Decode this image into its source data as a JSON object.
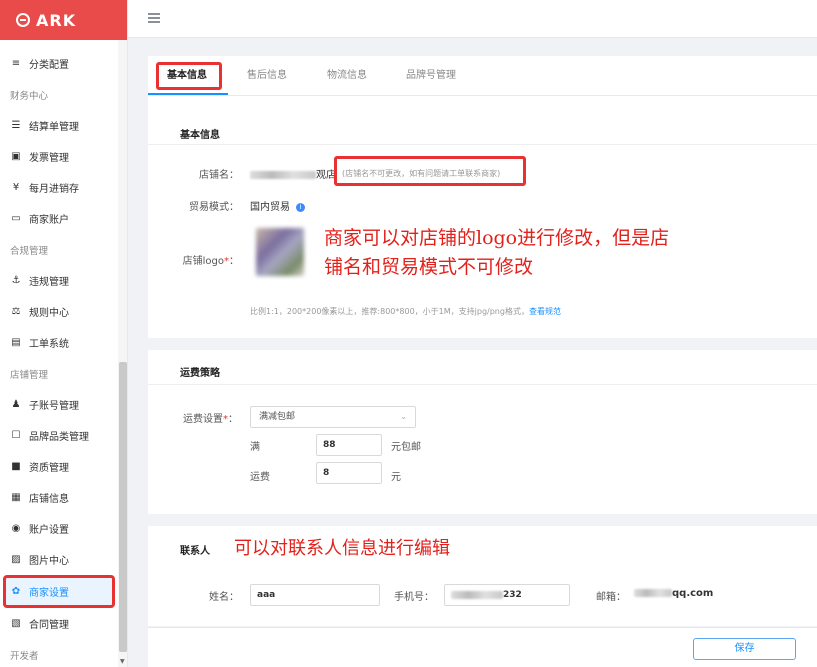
{
  "app": {
    "logo_text": "ARK",
    "brand_color": "#e94b4b",
    "accent_color": "#1890ff",
    "annotation_color": "#e3211b"
  },
  "sidebar": {
    "items": [
      {
        "type": "item",
        "icon": "menu-lines-icon",
        "glyph": "≡",
        "label": "分类配置"
      },
      {
        "type": "group",
        "label": "财务中心"
      },
      {
        "type": "item",
        "icon": "list-icon",
        "glyph": "☰",
        "label": "结算单管理"
      },
      {
        "type": "item",
        "icon": "invoice-icon",
        "glyph": "▣",
        "label": "发票管理"
      },
      {
        "type": "item",
        "icon": "yen-icon",
        "glyph": "¥",
        "label": "每月进销存"
      },
      {
        "type": "item",
        "icon": "card-icon",
        "glyph": "▭",
        "label": "商家账户"
      },
      {
        "type": "group",
        "label": "合规管理"
      },
      {
        "type": "item",
        "icon": "anchor-icon",
        "glyph": "⚓",
        "label": "违规管理"
      },
      {
        "type": "item",
        "icon": "scale-icon",
        "glyph": "⚖",
        "label": "规则中心"
      },
      {
        "type": "item",
        "icon": "calendar-icon",
        "glyph": "▤",
        "label": "工单系统"
      },
      {
        "type": "group",
        "label": "店铺管理"
      },
      {
        "type": "item",
        "icon": "user-icon",
        "glyph": "♟",
        "label": "子账号管理"
      },
      {
        "type": "item",
        "icon": "bookmark-outline-icon",
        "glyph": "☐",
        "label": "品牌品类管理"
      },
      {
        "type": "item",
        "icon": "bookmark-icon",
        "glyph": "■",
        "label": "资质管理"
      },
      {
        "type": "item",
        "icon": "id-card-icon",
        "glyph": "▦",
        "label": "店铺信息"
      },
      {
        "type": "item",
        "icon": "account-icon",
        "glyph": "◉",
        "label": "账户设置"
      },
      {
        "type": "item",
        "icon": "image-icon",
        "glyph": "▨",
        "label": "图片中心"
      },
      {
        "type": "item",
        "icon": "gear-icon",
        "glyph": "✿",
        "label": "商家设置",
        "active": true
      },
      {
        "type": "item",
        "icon": "contract-icon",
        "glyph": "▧",
        "label": "合同管理"
      },
      {
        "type": "group",
        "label": "开发者"
      }
    ]
  },
  "tabs": [
    {
      "label": "基本信息",
      "active": true
    },
    {
      "label": "售后信息"
    },
    {
      "label": "物流信息"
    },
    {
      "label": "品牌号管理"
    }
  ],
  "basic": {
    "title": "基本信息",
    "store_name_label": "店铺名：",
    "store_name_suffix": "观店",
    "store_name_hint": "(店铺名不可更改，如有问题请工单联系商家)",
    "trade_mode_label": "贸易模式：",
    "trade_mode_value": "国内贸易",
    "logo_label": "店铺logo",
    "logo_hint_prefix": "比例1:1，200*200像素以上，",
    "logo_hint_mid": "推荐:800*800，小于1M，支持jpg/png格式，",
    "logo_hint_link": "查看规范",
    "annotation": "商家可以对店铺的logo进行修改，但是店铺名和贸易模式不可修改"
  },
  "shipping": {
    "title": "运费策略",
    "fee_label": "运费设置",
    "fee_select": "满减包邮",
    "full_label": "满",
    "full_value": "88",
    "full_unit": "元包邮",
    "fee_amount_label": "运费",
    "fee_amount_value": "8",
    "fee_amount_unit": "元"
  },
  "contact": {
    "title": "联系人",
    "annotation": "可以对联系人信息进行编辑",
    "name_label": "姓名：",
    "name_value": "aaa",
    "phone_label": "手机号：",
    "phone_suffix": "232",
    "email_label": "邮箱：",
    "email_suffix": "qq.com"
  },
  "footer": {
    "save_label": "保存"
  }
}
